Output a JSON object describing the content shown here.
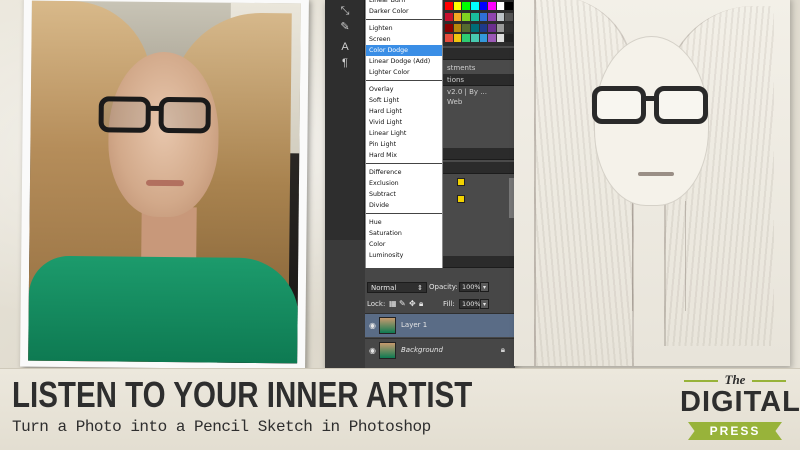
{
  "blend_menu": {
    "groups": [
      [
        "Linear Burn",
        "Darker Color"
      ],
      [
        "Lighten",
        "Screen",
        "Color Dodge",
        "Linear Dodge (Add)",
        "Lighter Color"
      ],
      [
        "Overlay",
        "Soft Light",
        "Hard Light",
        "Vivid Light",
        "Linear Light",
        "Pin Light",
        "Hard Mix"
      ],
      [
        "Difference",
        "Exclusion",
        "Subtract",
        "Divide"
      ],
      [
        "Hue",
        "Saturation",
        "Color",
        "Luminosity"
      ]
    ],
    "selected": "Color Dodge"
  },
  "side_panel": {
    "adjustments_label": "stments",
    "actions_label": "tions",
    "version_text": "v2.0 | By ...",
    "web_label": "Web"
  },
  "layers_panel": {
    "blend_mode": "Normal",
    "opacity_label": "Opacity:",
    "opacity_value": "100%",
    "lock_label": "Lock:",
    "fill_label": "Fill:",
    "fill_value": "100%",
    "layers": [
      {
        "name": "Layer 1",
        "active": true
      },
      {
        "name": "Background",
        "active": false
      }
    ]
  },
  "banner": {
    "title": "LISTEN TO YOUR INNER ARTIST",
    "subtitle": "Turn a Photo into a Pencil Sketch in Photoshop"
  },
  "logo": {
    "the": "The",
    "digital": "DIGITAL",
    "press": "PRESS"
  },
  "colors": {
    "accent_green": "#98b33a",
    "selection_blue": "#3a8ee6",
    "layer_active": "#5a6c86"
  },
  "swatch_colors": [
    "#ff0000",
    "#ffff00",
    "#00ff00",
    "#00ffff",
    "#0000ff",
    "#ff00ff",
    "#ffffff",
    "#000000",
    "#c8102e",
    "#f5a623",
    "#7ed321",
    "#1abc9c",
    "#2f6fd6",
    "#8e44ad",
    "#bdc3c7",
    "#555555",
    "#8b0000",
    "#b8860b",
    "#556b2f",
    "#006d77",
    "#1e3a8a",
    "#6b2f8e",
    "#999999",
    "#333333",
    "#e74c3c",
    "#f1c40f",
    "#2ecc71",
    "#48c9b0",
    "#3498db",
    "#9b59b6",
    "#dddddd",
    "#222222"
  ]
}
